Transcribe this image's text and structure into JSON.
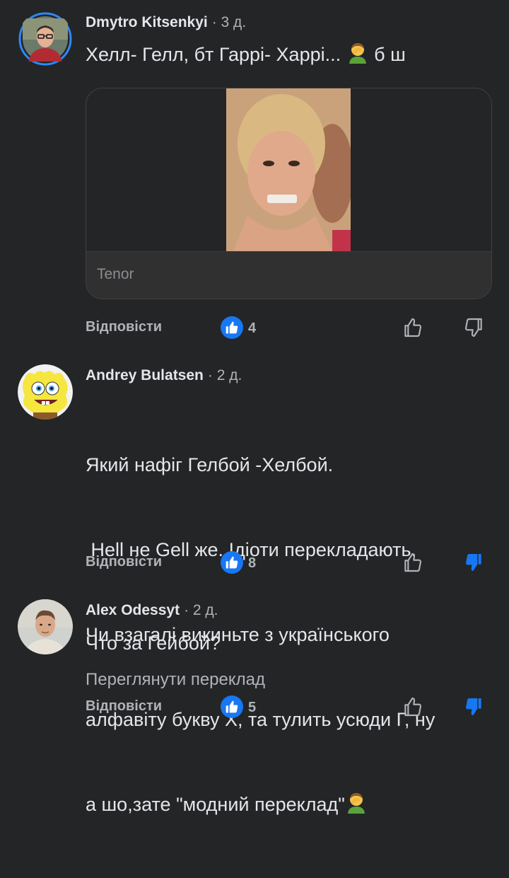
{
  "comments": [
    {
      "author": "Dmytro Kitsenkyi",
      "time": "· 3 д.",
      "text_before_emoji": "Хелл- Гелл, бт Гаррі- Харрі... ",
      "text_after_emoji": " б ш",
      "emoji": "facepalm-emoji",
      "attachment": {
        "source": "Tenor"
      },
      "reply_label": "Відповісти",
      "like_count": "4",
      "downvoted": false
    },
    {
      "author": "Andrey Bulatsen",
      "time": "· 2 д.",
      "text_lines": [
        "Який нафіг Гелбой -Хелбой.",
        " Hell не Gell же. Ідіоти перекладають.",
        "Чи взагалі викиньте з українського",
        "алфавіту букву Х, та тулить усюди Г, ну",
        "а шо,зате \"модний переклад\""
      ],
      "emoji": "facepalm-emoji",
      "reply_label": "Відповісти",
      "like_count": "8",
      "downvoted": true
    },
    {
      "author": "Alex Odessyt",
      "time": "· 2 д.",
      "text": "Что за Гейбой?",
      "translate_label": "Переглянути переклад",
      "reply_label": "Відповісти",
      "like_count": "5",
      "downvoted": true
    }
  ],
  "colors": {
    "background": "#242526",
    "text_primary": "#e4e6eb",
    "text_secondary": "#b0b3b8",
    "accent_blue": "#1877f2",
    "story_ring": "#2d88ff"
  }
}
